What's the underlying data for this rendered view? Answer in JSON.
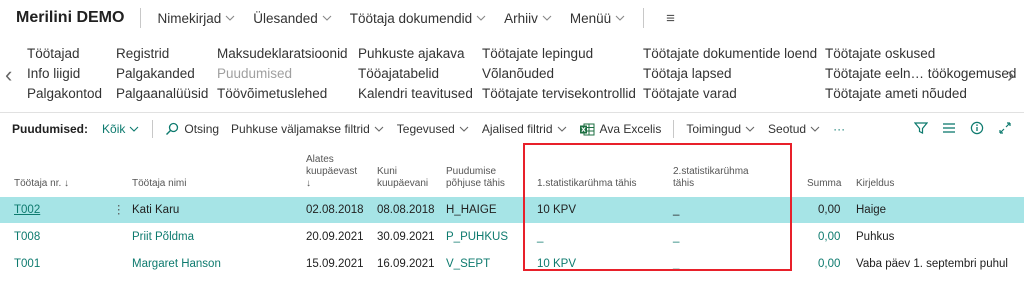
{
  "app": {
    "company": "Merilini DEMO"
  },
  "nav": {
    "items": [
      "Nimekirjad",
      "Ülesanded",
      "Töötaja dokumendid",
      "Arhiiv",
      "Menüü"
    ],
    "hamburger": "≡"
  },
  "actions": {
    "columns": [
      [
        "Töötajad",
        "Info liigid",
        "Palgakontod"
      ],
      [
        "Registrid",
        "Palgakanded",
        "Palgaanalüüsid"
      ],
      [
        "Maksudeklaratsioonid",
        "Puudumised",
        "Töövõimetuslehed"
      ],
      [
        "Puhkuste ajakava",
        "Tööajatabelid",
        "Kalendri teavitused"
      ],
      [
        "Töötajate lepingud",
        "Võlanõuded",
        "Töötajate tervisekontrollid"
      ],
      [
        "Töötajate dokumentide loend",
        "Töötaja lapsed",
        "Töötajate varad"
      ],
      [
        "Töötajate oskused",
        "Töötajate eeln… töökogemused",
        "Töötajate ameti nõuded"
      ]
    ],
    "left_arrow": "‹",
    "right_arrow": "›"
  },
  "toolbar": {
    "title": "Puudumised:",
    "filter": "Kõik",
    "search": "Otsing",
    "items": [
      "Puhkuse väljamakse filtrid",
      "Tegevused",
      "Ajalised filtrid"
    ],
    "excel": "Ava Excelis",
    "items2": [
      "Toimingud",
      "Seotud"
    ],
    "more": "···"
  },
  "table": {
    "headers": {
      "nr": "Töötaja nr. ↓",
      "name": "Töötaja nimi",
      "from": [
        "Alates",
        "kuupäevast",
        "↓"
      ],
      "to": [
        "Kuni",
        "kuupäevani"
      ],
      "reason": [
        "Puudumise",
        "põhjuse tähis"
      ],
      "stat1": "1.statistikarühma tähis",
      "stat2": [
        "2.statistikarühma",
        "tähis"
      ],
      "sum": "Summa",
      "desc": "Kirjeldus"
    },
    "rows": [
      {
        "nr": "T002",
        "name": "Kati Karu",
        "from": "02.08.2018",
        "to": "08.08.2018",
        "reason": "H_HAIGE",
        "stat1": "10 KPV",
        "stat2": "_",
        "sum": "0,00",
        "desc": "Haige"
      },
      {
        "nr": "T008",
        "name": "Priit Põldma",
        "from": "20.09.2021",
        "to": "30.09.2021",
        "reason": "P_PUHKUS",
        "stat1": "_",
        "stat2": "_",
        "sum": "0,00",
        "desc": "Puhkus"
      },
      {
        "nr": "T001",
        "name": "Margaret Hanson",
        "from": "15.09.2021",
        "to": "16.09.2021",
        "reason": "V_SEPT",
        "stat1": "10 KPV",
        "stat2": "_",
        "sum": "0,00",
        "desc": "Vaba päev 1. septembri puhul"
      }
    ],
    "row_menu": "⋮"
  },
  "colors": {
    "accent": "#0d7a6e",
    "selected_row": "#a6e4e6",
    "highlight_box": "#e8202a"
  }
}
